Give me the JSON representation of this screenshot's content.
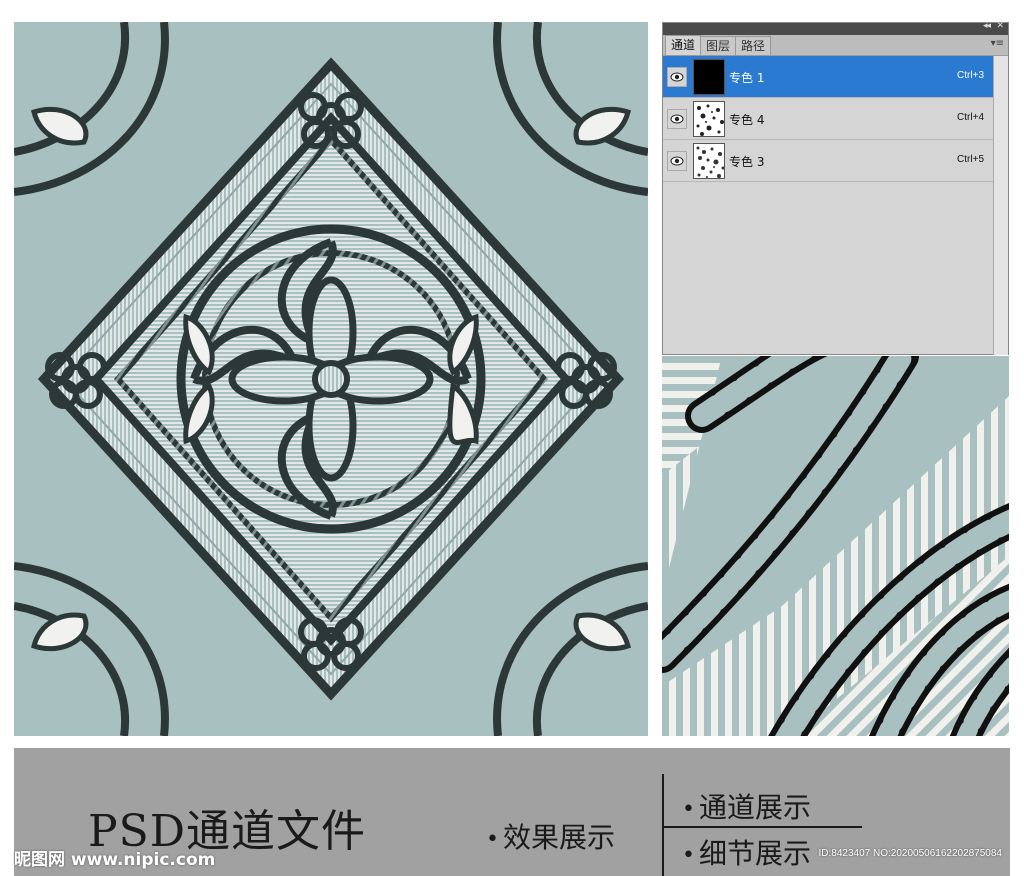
{
  "colors": {
    "pattern_background": "#a9c0c0",
    "stripe_light": "#dfe6e3",
    "rope_dark": "#2c3838",
    "selection_blue": "#2a7ad2",
    "banner_gray": "#a1a1a1"
  },
  "channels_panel": {
    "tabs": [
      "通道",
      "图层",
      "路径"
    ],
    "active_tab": "通道",
    "channels": [
      {
        "name": "专色 1",
        "shortcut": "Ctrl+3",
        "selected": true,
        "thumbnail": "solid-black"
      },
      {
        "name": "专色 4",
        "shortcut": "Ctrl+4",
        "selected": false,
        "thumbnail": "speckle"
      },
      {
        "name": "专色 3",
        "shortcut": "Ctrl+5",
        "selected": false,
        "thumbnail": "speckle"
      }
    ],
    "icons": {
      "visibility": "eye-icon",
      "panel_menu": "panel-menu-icon",
      "collapse": "collapse-arrows-icon"
    }
  },
  "banner": {
    "title": "PSD通道文件",
    "items": [
      {
        "label": "效果展示"
      },
      {
        "label": "通道展示"
      },
      {
        "label": "细节展示"
      }
    ],
    "bullet": "•"
  },
  "watermark": {
    "site": "昵图网 www.nipic.com",
    "id": "ID:8423407 NO:20200506162202875084"
  }
}
